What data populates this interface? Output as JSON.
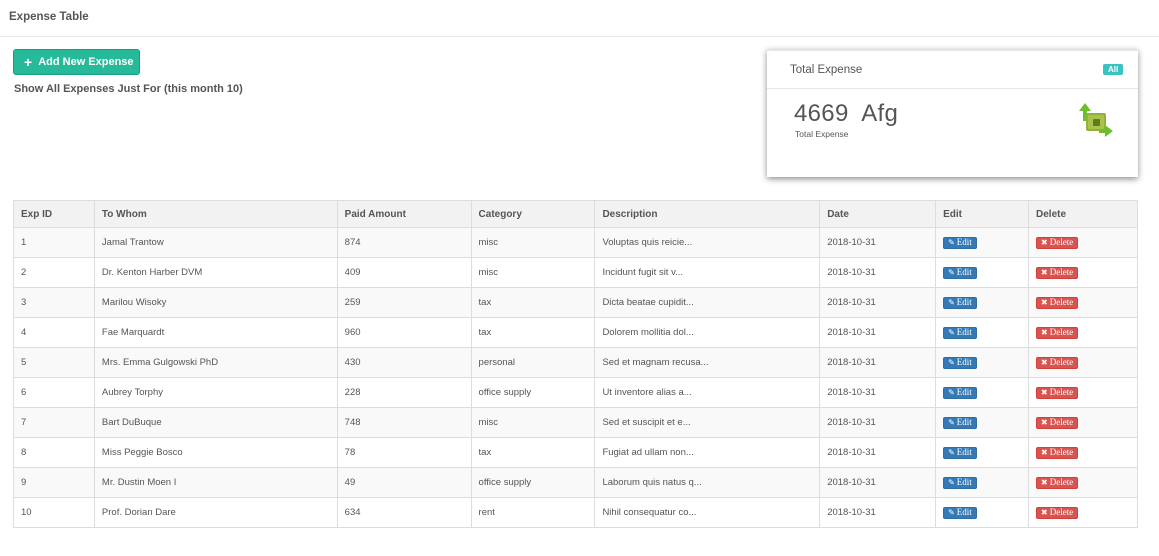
{
  "page": {
    "title": "Expense Table"
  },
  "actions": {
    "add_label": "Add New Expense",
    "filter_text": "Show All Expenses Just For (this month 10)"
  },
  "total_card": {
    "title": "Total Expense",
    "badge": "All",
    "amount": "4669  Afg",
    "subtitle": "Total Expense",
    "icon": "money-icon"
  },
  "table": {
    "headers": [
      "Exp ID",
      "To Whom",
      "Paid Amount",
      "Category",
      "Description",
      "Date",
      "Edit",
      "Delete"
    ],
    "edit_label": "Edit",
    "delete_label": "Delete",
    "rows": [
      {
        "id": "1",
        "to_whom": "Jamal Trantow",
        "amount": "874",
        "category": "misc",
        "description": "Voluptas quis reicie...",
        "date": "2018-10-31"
      },
      {
        "id": "2",
        "to_whom": "Dr. Kenton Harber DVM",
        "amount": "409",
        "category": "misc",
        "description": "Incidunt fugit sit v...",
        "date": "2018-10-31"
      },
      {
        "id": "3",
        "to_whom": "Marilou Wisoky",
        "amount": "259",
        "category": "tax",
        "description": "Dicta beatae cupidit...",
        "date": "2018-10-31"
      },
      {
        "id": "4",
        "to_whom": "Fae Marquardt",
        "amount": "960",
        "category": "tax",
        "description": "Dolorem mollitia dol...",
        "date": "2018-10-31"
      },
      {
        "id": "5",
        "to_whom": "Mrs. Emma Gulgowski PhD",
        "amount": "430",
        "category": "personal",
        "description": "Sed et magnam recusa...",
        "date": "2018-10-31"
      },
      {
        "id": "6",
        "to_whom": "Aubrey Torphy",
        "amount": "228",
        "category": "office supply",
        "description": "Ut inventore alias a...",
        "date": "2018-10-31"
      },
      {
        "id": "7",
        "to_whom": "Bart DuBuque",
        "amount": "748",
        "category": "misc",
        "description": "Sed et suscipit et e...",
        "date": "2018-10-31"
      },
      {
        "id": "8",
        "to_whom": "Miss Peggie Bosco",
        "amount": "78",
        "category": "tax",
        "description": "Fugiat ad ullam non...",
        "date": "2018-10-31"
      },
      {
        "id": "9",
        "to_whom": "Mr. Dustin Moen I",
        "amount": "49",
        "category": "office supply",
        "description": "Laborum quis natus q...",
        "date": "2018-10-31"
      },
      {
        "id": "10",
        "to_whom": "Prof. Dorian Dare",
        "amount": "634",
        "category": "rent",
        "description": "Nihil consequatur co...",
        "date": "2018-10-31"
      }
    ]
  },
  "colors": {
    "primary": "#26b99a",
    "edit": "#337ab7",
    "delete": "#d9534f",
    "badge": "#3bc3c1"
  }
}
